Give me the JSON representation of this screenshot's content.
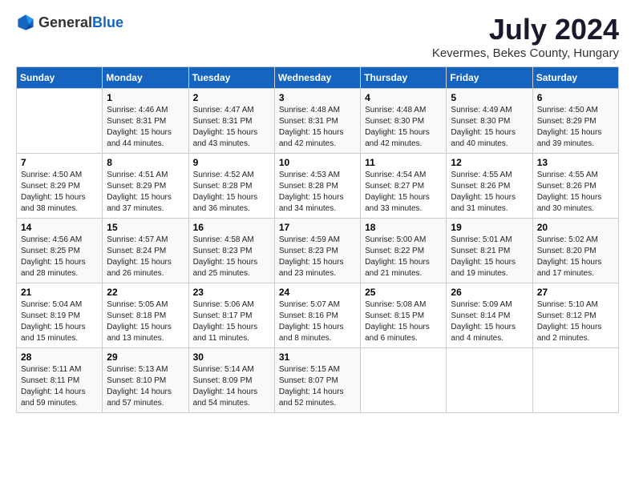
{
  "header": {
    "logo_general": "General",
    "logo_blue": "Blue",
    "month": "July 2024",
    "location": "Kevermes, Bekes County, Hungary"
  },
  "days_of_week": [
    "Sunday",
    "Monday",
    "Tuesday",
    "Wednesday",
    "Thursday",
    "Friday",
    "Saturday"
  ],
  "weeks": [
    [
      {
        "day": "",
        "sunrise": "",
        "sunset": "",
        "daylight": ""
      },
      {
        "day": "1",
        "sunrise": "Sunrise: 4:46 AM",
        "sunset": "Sunset: 8:31 PM",
        "daylight": "Daylight: 15 hours and 44 minutes."
      },
      {
        "day": "2",
        "sunrise": "Sunrise: 4:47 AM",
        "sunset": "Sunset: 8:31 PM",
        "daylight": "Daylight: 15 hours and 43 minutes."
      },
      {
        "day": "3",
        "sunrise": "Sunrise: 4:48 AM",
        "sunset": "Sunset: 8:31 PM",
        "daylight": "Daylight: 15 hours and 42 minutes."
      },
      {
        "day": "4",
        "sunrise": "Sunrise: 4:48 AM",
        "sunset": "Sunset: 8:30 PM",
        "daylight": "Daylight: 15 hours and 42 minutes."
      },
      {
        "day": "5",
        "sunrise": "Sunrise: 4:49 AM",
        "sunset": "Sunset: 8:30 PM",
        "daylight": "Daylight: 15 hours and 40 minutes."
      },
      {
        "day": "6",
        "sunrise": "Sunrise: 4:50 AM",
        "sunset": "Sunset: 8:29 PM",
        "daylight": "Daylight: 15 hours and 39 minutes."
      }
    ],
    [
      {
        "day": "7",
        "sunrise": "Sunrise: 4:50 AM",
        "sunset": "Sunset: 8:29 PM",
        "daylight": "Daylight: 15 hours and 38 minutes."
      },
      {
        "day": "8",
        "sunrise": "Sunrise: 4:51 AM",
        "sunset": "Sunset: 8:29 PM",
        "daylight": "Daylight: 15 hours and 37 minutes."
      },
      {
        "day": "9",
        "sunrise": "Sunrise: 4:52 AM",
        "sunset": "Sunset: 8:28 PM",
        "daylight": "Daylight: 15 hours and 36 minutes."
      },
      {
        "day": "10",
        "sunrise": "Sunrise: 4:53 AM",
        "sunset": "Sunset: 8:28 PM",
        "daylight": "Daylight: 15 hours and 34 minutes."
      },
      {
        "day": "11",
        "sunrise": "Sunrise: 4:54 AM",
        "sunset": "Sunset: 8:27 PM",
        "daylight": "Daylight: 15 hours and 33 minutes."
      },
      {
        "day": "12",
        "sunrise": "Sunrise: 4:55 AM",
        "sunset": "Sunset: 8:26 PM",
        "daylight": "Daylight: 15 hours and 31 minutes."
      },
      {
        "day": "13",
        "sunrise": "Sunrise: 4:55 AM",
        "sunset": "Sunset: 8:26 PM",
        "daylight": "Daylight: 15 hours and 30 minutes."
      }
    ],
    [
      {
        "day": "14",
        "sunrise": "Sunrise: 4:56 AM",
        "sunset": "Sunset: 8:25 PM",
        "daylight": "Daylight: 15 hours and 28 minutes."
      },
      {
        "day": "15",
        "sunrise": "Sunrise: 4:57 AM",
        "sunset": "Sunset: 8:24 PM",
        "daylight": "Daylight: 15 hours and 26 minutes."
      },
      {
        "day": "16",
        "sunrise": "Sunrise: 4:58 AM",
        "sunset": "Sunset: 8:23 PM",
        "daylight": "Daylight: 15 hours and 25 minutes."
      },
      {
        "day": "17",
        "sunrise": "Sunrise: 4:59 AM",
        "sunset": "Sunset: 8:23 PM",
        "daylight": "Daylight: 15 hours and 23 minutes."
      },
      {
        "day": "18",
        "sunrise": "Sunrise: 5:00 AM",
        "sunset": "Sunset: 8:22 PM",
        "daylight": "Daylight: 15 hours and 21 minutes."
      },
      {
        "day": "19",
        "sunrise": "Sunrise: 5:01 AM",
        "sunset": "Sunset: 8:21 PM",
        "daylight": "Daylight: 15 hours and 19 minutes."
      },
      {
        "day": "20",
        "sunrise": "Sunrise: 5:02 AM",
        "sunset": "Sunset: 8:20 PM",
        "daylight": "Daylight: 15 hours and 17 minutes."
      }
    ],
    [
      {
        "day": "21",
        "sunrise": "Sunrise: 5:04 AM",
        "sunset": "Sunset: 8:19 PM",
        "daylight": "Daylight: 15 hours and 15 minutes."
      },
      {
        "day": "22",
        "sunrise": "Sunrise: 5:05 AM",
        "sunset": "Sunset: 8:18 PM",
        "daylight": "Daylight: 15 hours and 13 minutes."
      },
      {
        "day": "23",
        "sunrise": "Sunrise: 5:06 AM",
        "sunset": "Sunset: 8:17 PM",
        "daylight": "Daylight: 15 hours and 11 minutes."
      },
      {
        "day": "24",
        "sunrise": "Sunrise: 5:07 AM",
        "sunset": "Sunset: 8:16 PM",
        "daylight": "Daylight: 15 hours and 8 minutes."
      },
      {
        "day": "25",
        "sunrise": "Sunrise: 5:08 AM",
        "sunset": "Sunset: 8:15 PM",
        "daylight": "Daylight: 15 hours and 6 minutes."
      },
      {
        "day": "26",
        "sunrise": "Sunrise: 5:09 AM",
        "sunset": "Sunset: 8:14 PM",
        "daylight": "Daylight: 15 hours and 4 minutes."
      },
      {
        "day": "27",
        "sunrise": "Sunrise: 5:10 AM",
        "sunset": "Sunset: 8:12 PM",
        "daylight": "Daylight: 15 hours and 2 minutes."
      }
    ],
    [
      {
        "day": "28",
        "sunrise": "Sunrise: 5:11 AM",
        "sunset": "Sunset: 8:11 PM",
        "daylight": "Daylight: 14 hours and 59 minutes."
      },
      {
        "day": "29",
        "sunrise": "Sunrise: 5:13 AM",
        "sunset": "Sunset: 8:10 PM",
        "daylight": "Daylight: 14 hours and 57 minutes."
      },
      {
        "day": "30",
        "sunrise": "Sunrise: 5:14 AM",
        "sunset": "Sunset: 8:09 PM",
        "daylight": "Daylight: 14 hours and 54 minutes."
      },
      {
        "day": "31",
        "sunrise": "Sunrise: 5:15 AM",
        "sunset": "Sunset: 8:07 PM",
        "daylight": "Daylight: 14 hours and 52 minutes."
      },
      {
        "day": "",
        "sunrise": "",
        "sunset": "",
        "daylight": ""
      },
      {
        "day": "",
        "sunrise": "",
        "sunset": "",
        "daylight": ""
      },
      {
        "day": "",
        "sunrise": "",
        "sunset": "",
        "daylight": ""
      }
    ]
  ]
}
